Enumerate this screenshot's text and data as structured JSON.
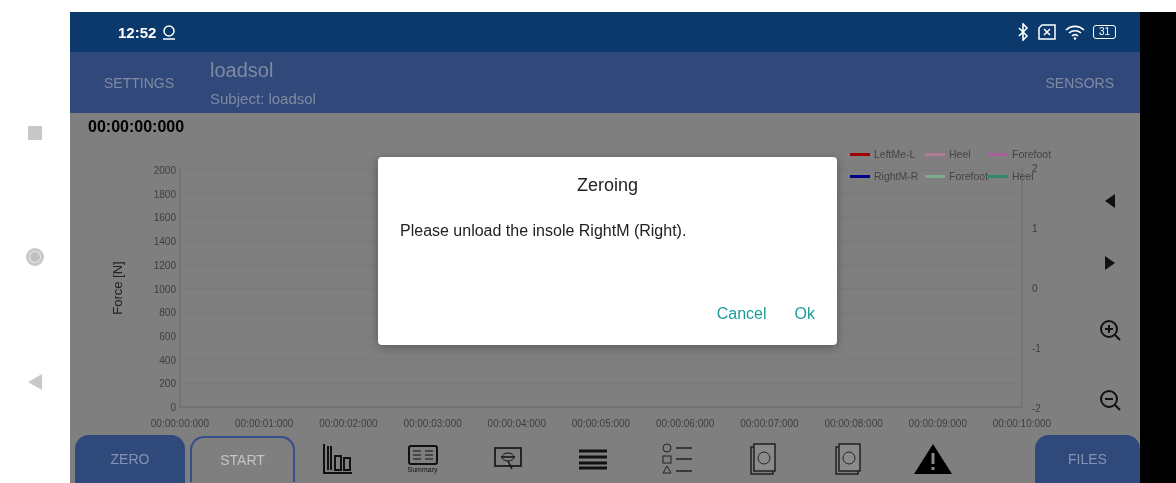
{
  "status_bar": {
    "time": "12:52",
    "battery": "31"
  },
  "app_bar": {
    "settings": "SETTINGS",
    "title": "loadsol",
    "subtitle": "Subject: loadsol",
    "sensors": "SENSORS"
  },
  "timer": "00:00:00:000",
  "chart": {
    "chart_data": {
      "type": "line",
      "ylabel": "Force [N]",
      "x": [
        "00:00:00:000",
        "00:00:01:000",
        "00:00:02:000",
        "00:00:03:000",
        "00:00:04:000",
        "00:00:05:000",
        "00:00:06:000",
        "00:00:07:000",
        "00:00:08:000",
        "00:00:09:000",
        "00:00:10:000"
      ],
      "ylim": [
        0,
        2000
      ],
      "yticks": [
        0,
        200,
        400,
        600,
        800,
        1000,
        1200,
        1400,
        1600,
        1800,
        2000
      ],
      "series": [
        {
          "name": "LeftMe-L",
          "color": "#a00000",
          "values": [
            null,
            null,
            null,
            null,
            null,
            null,
            null,
            null,
            null,
            null,
            null
          ]
        },
        {
          "name": "Heel",
          "color": "#b07c94",
          "values": [
            null,
            null,
            null,
            null,
            null,
            null,
            null,
            null,
            null,
            null,
            null
          ]
        },
        {
          "name": "Forefoot",
          "color": "#a8609c",
          "values": [
            null,
            null,
            null,
            null,
            null,
            null,
            null,
            null,
            null,
            null,
            null
          ]
        },
        {
          "name": "RightM-R",
          "color": "#000088",
          "values": [
            null,
            null,
            null,
            null,
            null,
            null,
            null,
            null,
            null,
            null,
            null
          ]
        },
        {
          "name": "Forefoot",
          "color": "#7ca88c",
          "values": [
            null,
            null,
            null,
            null,
            null,
            null,
            null,
            null,
            null,
            null,
            null
          ]
        },
        {
          "name": "Heel",
          "color": "#2e8a68",
          "values": [
            null,
            null,
            null,
            null,
            null,
            null,
            null,
            null,
            null,
            null,
            null
          ]
        }
      ]
    },
    "right_axis_ticks": [
      "2",
      "1",
      "0",
      "-1",
      "-2"
    ]
  },
  "bottom_bar": {
    "zero": "ZERO",
    "start": "START",
    "summary_label": "Summary",
    "files": "FILES"
  },
  "dialog": {
    "title": "Zeroing",
    "message": "Please unload the insole RightM (Right).",
    "buttons": [
      "Cancel",
      "Ok"
    ]
  }
}
